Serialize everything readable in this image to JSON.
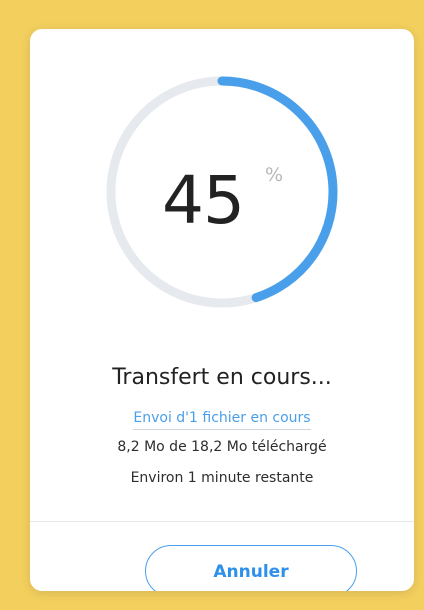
{
  "progress": {
    "value": "45",
    "percent_symbol": "%",
    "fraction": 0.45
  },
  "status": {
    "title": "Transfert en cours...",
    "sending": "Envoi d'1 fichier en cours",
    "downloaded": "8,2 Mo de 18,2 Mo téléchargé",
    "remaining": "Environ 1 minute restante"
  },
  "actions": {
    "cancel_label": "Annuler"
  },
  "colors": {
    "background": "#f3cf5e",
    "progress_track": "#e6e9ee",
    "progress_fill": "#4a9fea",
    "text_primary": "#222222",
    "accent": "#4a9fea"
  }
}
